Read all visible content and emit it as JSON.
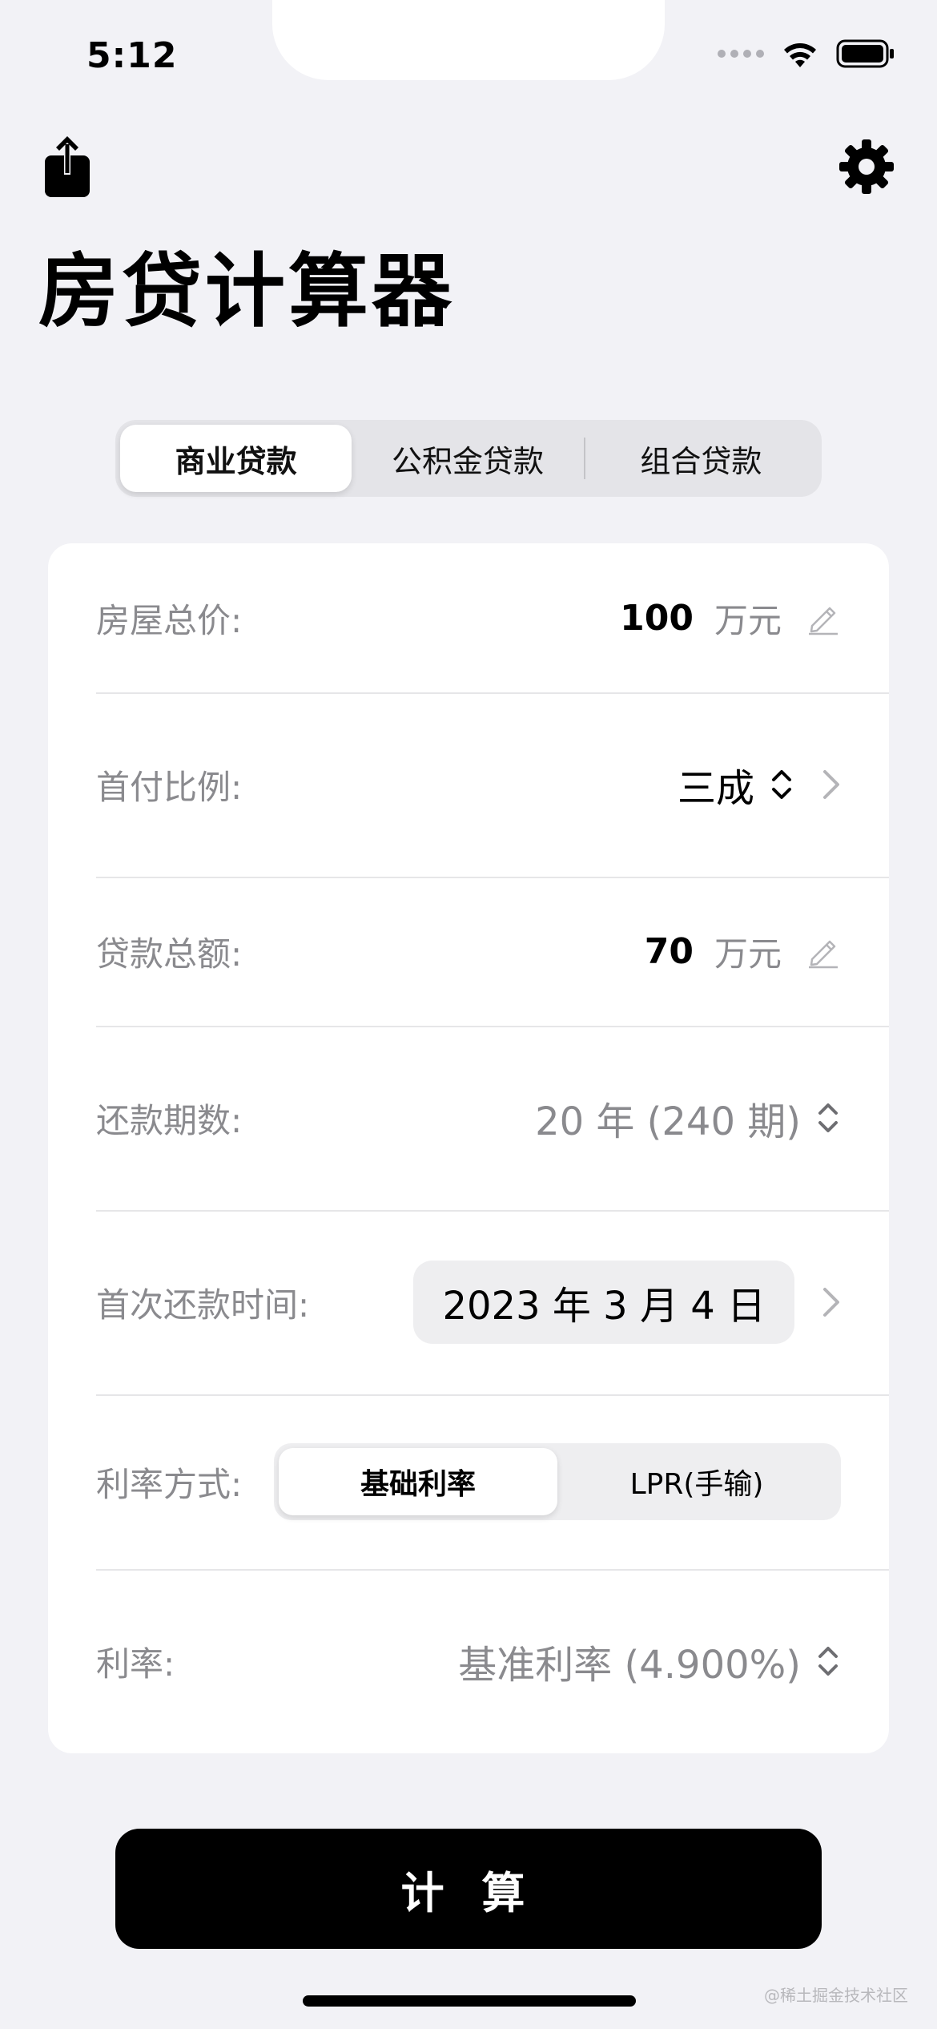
{
  "status_bar": {
    "time": "5:12",
    "icons": [
      "cellular-signal-icon",
      "wifi-icon",
      "battery-icon"
    ]
  },
  "header": {
    "share_icon": "share-icon",
    "settings_icon": "gear-icon",
    "title": "房贷计算器"
  },
  "loan_type_tabs": {
    "items": [
      {
        "label": "商业贷款",
        "selected": true
      },
      {
        "label": "公积金贷款",
        "selected": false
      },
      {
        "label": "组合贷款",
        "selected": false
      }
    ]
  },
  "form": {
    "house_price": {
      "label": "房屋总价:",
      "value": "100",
      "unit": "万元"
    },
    "down_payment": {
      "label": "首付比例:",
      "value": "三成"
    },
    "loan_amount": {
      "label": "贷款总额:",
      "value": "70",
      "unit": "万元"
    },
    "term": {
      "label": "还款期数:",
      "value": "20 年 (240 期)"
    },
    "first_payment": {
      "label": "首次还款时间:",
      "value": "2023 年 3 月 4 日"
    },
    "rate_mode": {
      "label": "利率方式:",
      "options": [
        {
          "label": "基础利率",
          "selected": true
        },
        {
          "label": "LPR(手输)",
          "selected": false
        }
      ]
    },
    "rate": {
      "label": "利率:",
      "value": "基准利率 (4.900%)"
    }
  },
  "calculate_button": {
    "label": "计 算"
  },
  "watermark": "@稀土掘金技术社区",
  "colors": {
    "background": "#f2f2f6",
    "card": "#ffffff",
    "secondary_text": "#8a8a8e",
    "primary_button": "#000000"
  }
}
